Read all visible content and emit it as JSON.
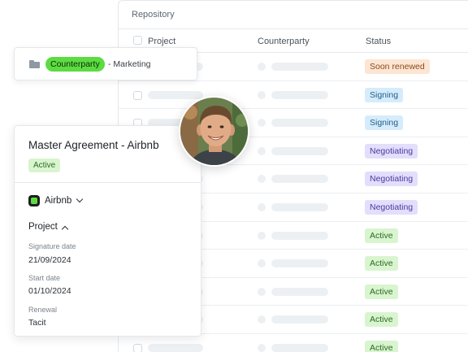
{
  "repository": {
    "title": "Repository",
    "columns": {
      "project": "Project",
      "counterparty": "Counterparty",
      "status": "Status"
    },
    "rows": [
      {
        "status": "Soon renewed",
        "bg": "#fde5d3",
        "fg": "#8a4a1c"
      },
      {
        "status": "Signing",
        "bg": "#d6ecfb",
        "fg": "#1e5f8e"
      },
      {
        "status": "Signing",
        "bg": "#d6ecfb",
        "fg": "#1e5f8e"
      },
      {
        "status": "Negotiating",
        "bg": "#e3defb",
        "fg": "#4a3aa0"
      },
      {
        "status": "Negotiating",
        "bg": "#e3defb",
        "fg": "#4a3aa0"
      },
      {
        "status": "Negotiating",
        "bg": "#e3defb",
        "fg": "#4a3aa0"
      },
      {
        "status": "Active",
        "bg": "#d8f5cf",
        "fg": "#2f6a21"
      },
      {
        "status": "Active",
        "bg": "#d8f5cf",
        "fg": "#2f6a21"
      },
      {
        "status": "Active",
        "bg": "#d8f5cf",
        "fg": "#2f6a21"
      },
      {
        "status": "Active",
        "bg": "#d8f5cf",
        "fg": "#2f6a21"
      },
      {
        "status": "Active",
        "bg": "#d8f5cf",
        "fg": "#2f6a21"
      }
    ]
  },
  "breadcrumb": {
    "icon": "folder-icon",
    "pill": "Counterparty",
    "suffix": "- Marketing"
  },
  "agreement": {
    "title": "Master Agreement - Airbnb",
    "status": "Active",
    "counterparty": "Airbnb",
    "project_header": "Project",
    "fields": [
      {
        "label": "Signature date",
        "value": "21/09/2024"
      },
      {
        "label": "Start date",
        "value": "01/10/2024"
      },
      {
        "label": "Renewal",
        "value": "Tacit"
      }
    ]
  },
  "colors": {
    "accent_green": "#5cdc41",
    "border": "#e4e7eb",
    "skeleton": "#edf0f3"
  }
}
